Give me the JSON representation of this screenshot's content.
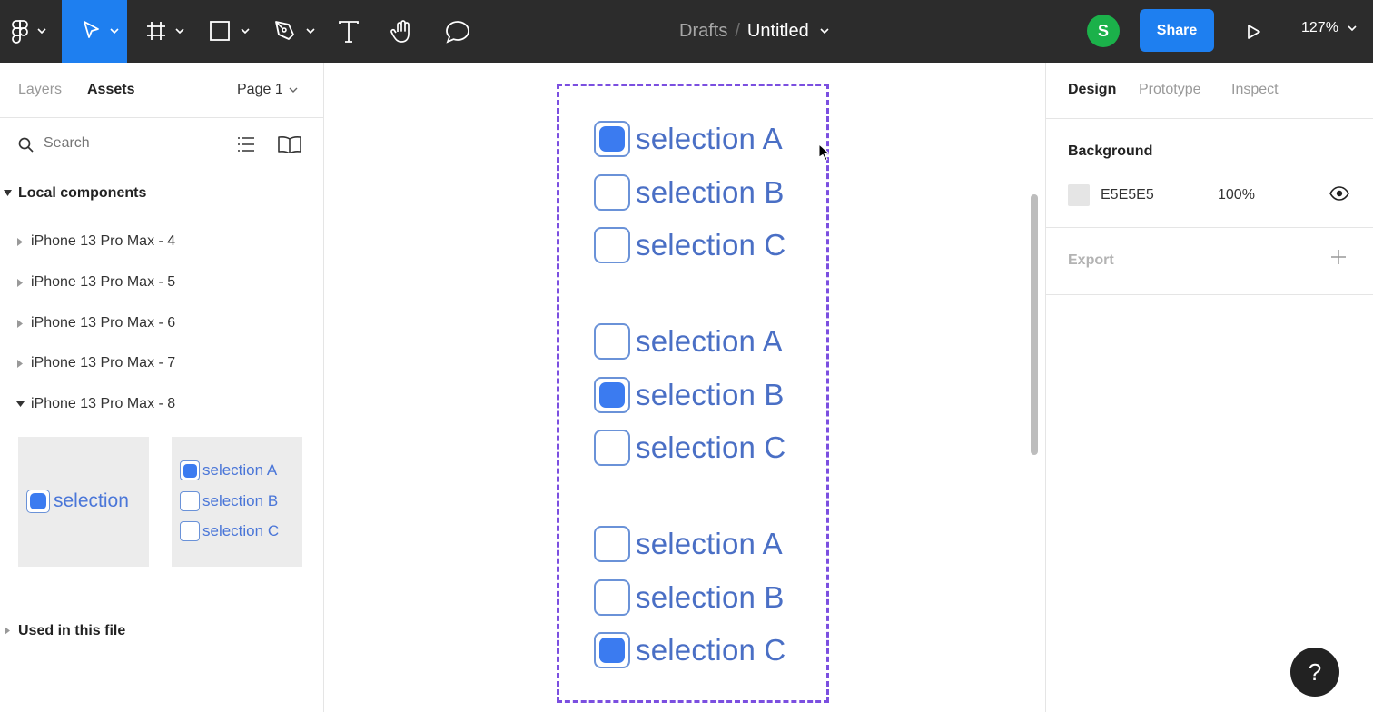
{
  "toolbar": {
    "main_menu_icon": "figma-logo-icon",
    "tools": [
      "move-tool",
      "frame-tool",
      "shape-tool",
      "pen-tool",
      "text-tool",
      "hand-tool",
      "comment-tool"
    ],
    "breadcrumb_drafts": "Drafts",
    "breadcrumb_separator": "/",
    "file_name": "Untitled",
    "avatar_initial": "S",
    "share_label": "Share",
    "zoom_level": "127%",
    "accent_color": "#1e7ff0"
  },
  "left_panel": {
    "tab_layers": "Layers",
    "tab_assets": "Assets",
    "page_selector": "Page 1",
    "search_placeholder": "Search",
    "local_components_title": "Local components",
    "components": [
      {
        "label": "iPhone 13 Pro Max - 4",
        "expanded": false
      },
      {
        "label": "iPhone 13 Pro Max - 5",
        "expanded": false
      },
      {
        "label": "iPhone 13 Pro Max - 6",
        "expanded": false
      },
      {
        "label": "iPhone 13 Pro Max - 7",
        "expanded": false
      },
      {
        "label": "iPhone 13 Pro Max - 8",
        "expanded": true
      }
    ],
    "thumb_single": {
      "label": "selection",
      "checked": true
    },
    "thumb_group": [
      {
        "label": "selection A",
        "checked": true
      },
      {
        "label": "selection B",
        "checked": false
      },
      {
        "label": "selection C",
        "checked": false
      }
    ],
    "used_in_file_title": "Used in this file"
  },
  "canvas": {
    "groups": [
      [
        {
          "label": "selection A",
          "checked": true
        },
        {
          "label": "selection B",
          "checked": false
        },
        {
          "label": "selection C",
          "checked": false
        }
      ],
      [
        {
          "label": "selection A",
          "checked": false
        },
        {
          "label": "selection B",
          "checked": true
        },
        {
          "label": "selection C",
          "checked": false
        }
      ],
      [
        {
          "label": "selection A",
          "checked": false
        },
        {
          "label": "selection B",
          "checked": false
        },
        {
          "label": "selection C",
          "checked": true
        }
      ]
    ],
    "frame_color": "#7b4fe0"
  },
  "right_panel": {
    "tab_design": "Design",
    "tab_prototype": "Prototype",
    "tab_inspect": "Inspect",
    "background_title": "Background",
    "background_hex": "E5E5E5",
    "background_opacity": "100%",
    "export_title": "Export"
  },
  "help_label": "?"
}
